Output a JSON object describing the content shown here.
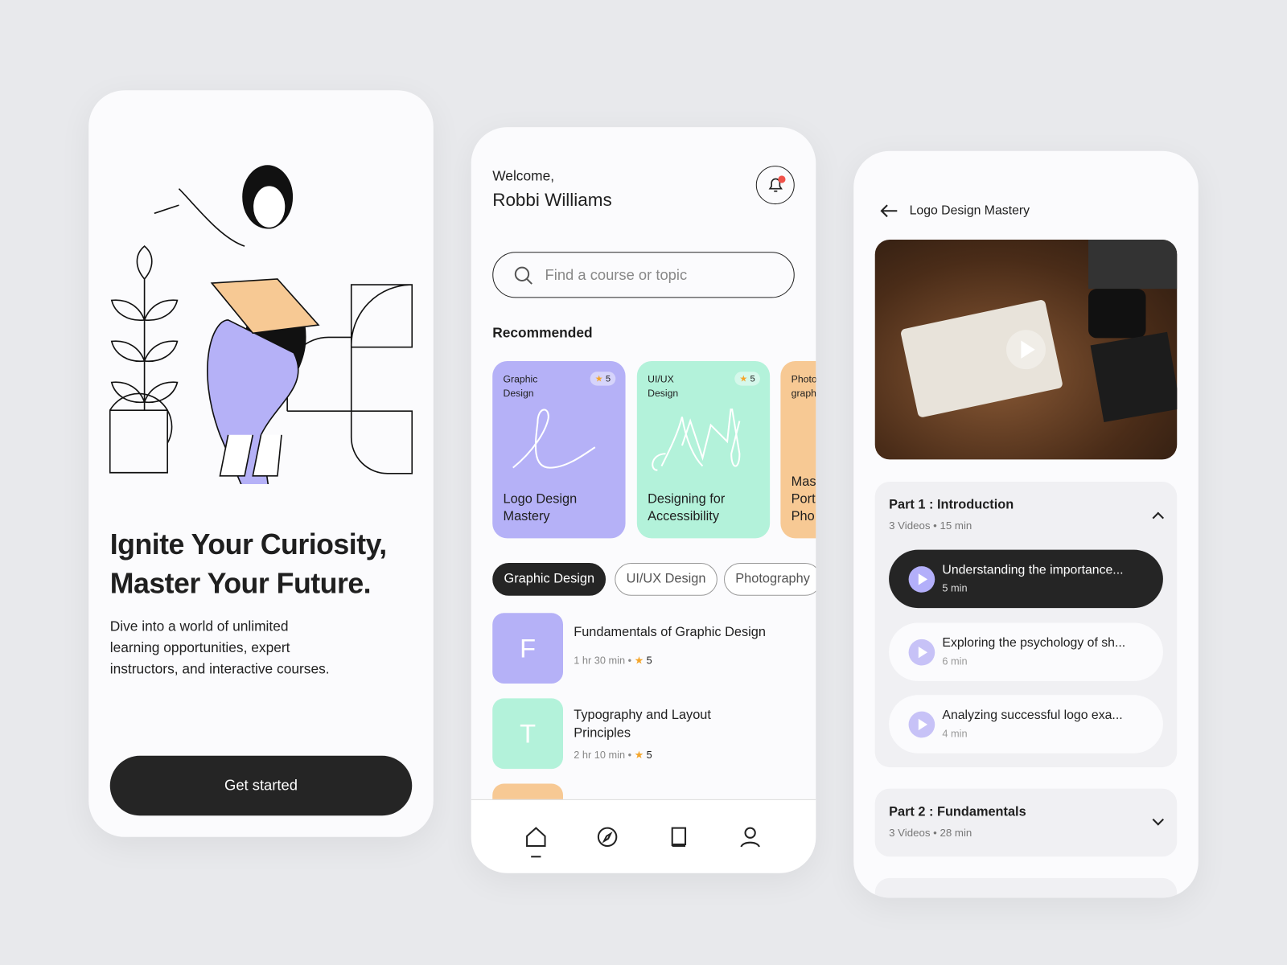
{
  "onboarding": {
    "headline_line1": "Ignite Your Curiosity,",
    "headline_line2": "Master Your Future.",
    "description_line1": "Dive into a world of unlimited",
    "description_line2": "learning opportunities, expert",
    "description_line3": "instructors, and interactive courses.",
    "cta_label": "Get started"
  },
  "home": {
    "greeting": "Welcome,",
    "user_name": "Robbi Williams",
    "search_placeholder": "Find a course or topic",
    "recommended_label": "Recommended",
    "cards": [
      {
        "category": "Graphic Design",
        "rating": "5",
        "title": "Logo Design Mastery",
        "color": "#b5b1f7"
      },
      {
        "category": "UI/UX Design",
        "rating": "5",
        "title": "Designing for Accessibility",
        "color": "#b3f2da"
      },
      {
        "category": "Photo graph",
        "title": "Mas Port Pho",
        "color": "#f7c994"
      }
    ],
    "chips": [
      "Graphic Design",
      "UI/UX Design",
      "Photography"
    ],
    "courses": [
      {
        "letter": "F",
        "title": "Fundamentals of Graphic Design",
        "duration": "1 hr 30 min",
        "rating": "5",
        "color": "#b5b1f7"
      },
      {
        "letter": "T",
        "title": "Typography and Layout Principles",
        "duration": "2 hr 10 min",
        "rating": "5",
        "color": "#b3f2da"
      }
    ],
    "nav": [
      "home-icon",
      "compass-icon",
      "book-icon",
      "profile-icon"
    ]
  },
  "detail": {
    "title": "Logo Design Mastery",
    "sections": [
      {
        "title": "Part 1 : Introduction",
        "meta": "3 Videos • 15 min",
        "expanded": true,
        "videos": [
          {
            "title": "Understanding the importance...",
            "duration": "5 min",
            "active": true
          },
          {
            "title": "Exploring the psychology of sh...",
            "duration": "6 min"
          },
          {
            "title": "Analyzing successful logo exa...",
            "duration": "4 min"
          }
        ]
      },
      {
        "title": "Part 2 : Fundamentals",
        "meta": "3 Videos • 28 min",
        "expanded": false
      }
    ]
  },
  "colors": {
    "accent": "#b5b1f7",
    "dark": "#252525",
    "mint": "#b3f2da",
    "peach": "#f7c994",
    "notification": "#f0524a"
  }
}
